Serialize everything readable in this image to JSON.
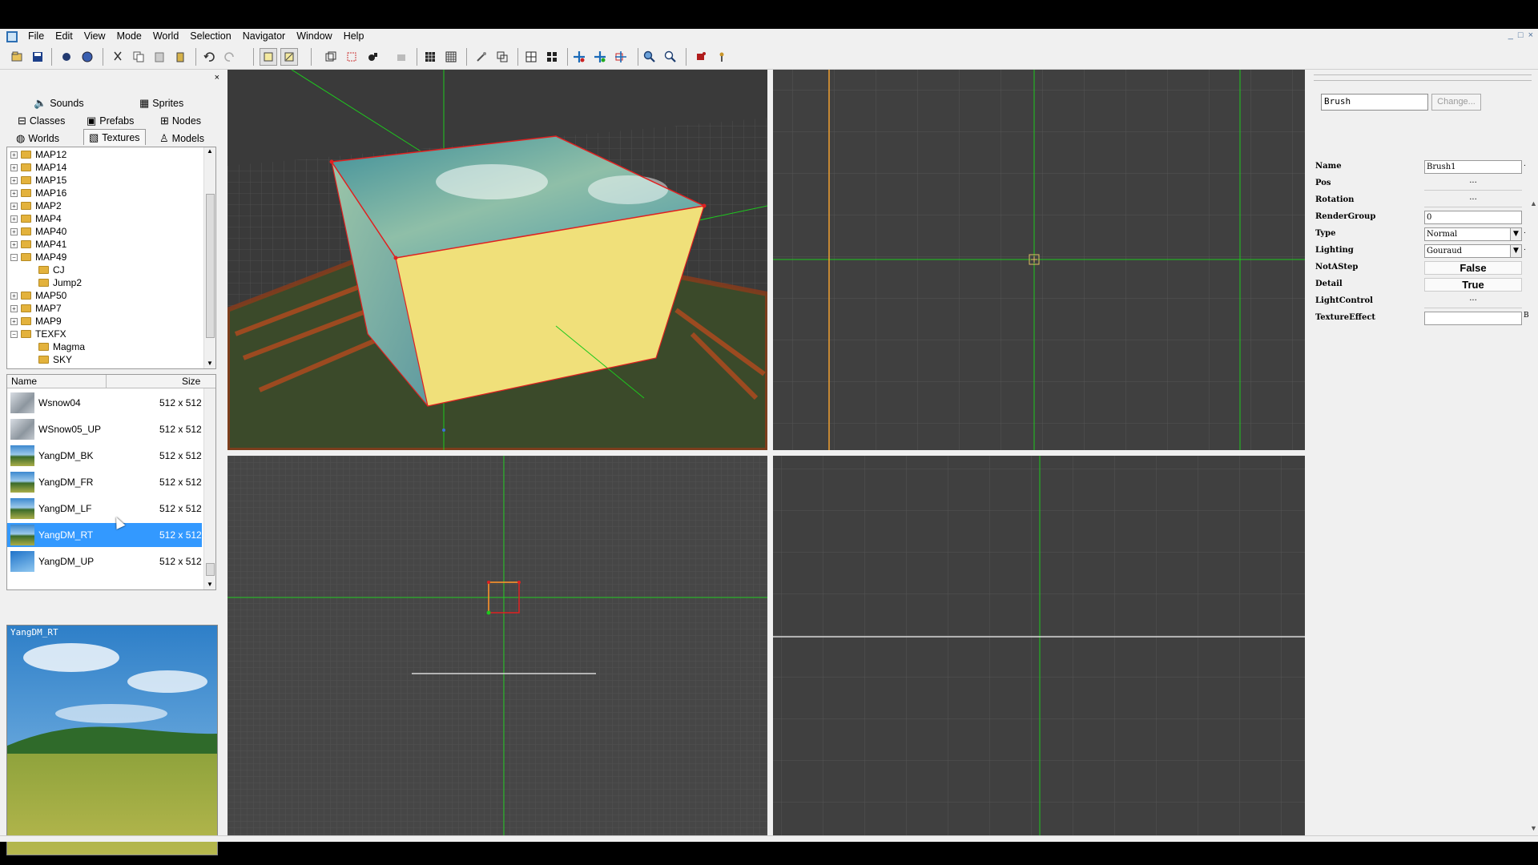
{
  "menu": [
    "File",
    "Edit",
    "View",
    "Mode",
    "World",
    "Selection",
    "Navigator",
    "Window",
    "Help"
  ],
  "window_controls": [
    "_",
    "□",
    "×"
  ],
  "left_close": "×",
  "tabs": {
    "sounds": "Sounds",
    "sprites": "Sprites",
    "classes": "Classes",
    "prefabs": "Prefabs",
    "nodes": "Nodes",
    "worlds": "Worlds",
    "textures": "Textures",
    "models": "Models"
  },
  "tree": [
    {
      "label": "MAP12",
      "expander": "+",
      "depth": 0
    },
    {
      "label": "MAP14",
      "expander": "+",
      "depth": 0
    },
    {
      "label": "MAP15",
      "expander": "+",
      "depth": 0
    },
    {
      "label": "MAP16",
      "expander": "+",
      "depth": 0
    },
    {
      "label": "MAP2",
      "expander": "+",
      "depth": 0
    },
    {
      "label": "MAP4",
      "expander": "+",
      "depth": 0
    },
    {
      "label": "MAP40",
      "expander": "+",
      "depth": 0
    },
    {
      "label": "MAP41",
      "expander": "+",
      "depth": 0
    },
    {
      "label": "MAP49",
      "expander": "−",
      "depth": 0
    },
    {
      "label": "CJ",
      "expander": "",
      "depth": 1
    },
    {
      "label": "Jump2",
      "expander": "",
      "depth": 1
    },
    {
      "label": "MAP50",
      "expander": "+",
      "depth": 0
    },
    {
      "label": "MAP7",
      "expander": "+",
      "depth": 0
    },
    {
      "label": "MAP9",
      "expander": "+",
      "depth": 0
    },
    {
      "label": "TEXFX",
      "expander": "−",
      "depth": 0
    },
    {
      "label": "Magma",
      "expander": "",
      "depth": 1
    },
    {
      "label": "SKY",
      "expander": "",
      "depth": 1
    }
  ],
  "list": {
    "col_name": "Name",
    "col_size": "Size",
    "rows": [
      {
        "name": "Wsnow04",
        "size": "512 x 512",
        "thumb": "snow"
      },
      {
        "name": "WSnow05_UP",
        "size": "512 x 512",
        "thumb": "snow"
      },
      {
        "name": "YangDM_BK",
        "size": "512 x 512",
        "thumb": "field"
      },
      {
        "name": "YangDM_FR",
        "size": "512 x 512",
        "thumb": "field"
      },
      {
        "name": "YangDM_LF",
        "size": "512 x 512",
        "thumb": "field"
      },
      {
        "name": "YangDM_RT",
        "size": "512 x 512",
        "thumb": "field",
        "selected": true
      },
      {
        "name": "YangDM_UP",
        "size": "512 x 512",
        "thumb": "sky"
      }
    ]
  },
  "preview": {
    "name": "YangDM_RT"
  },
  "properties": {
    "brush_field": "Brush",
    "change_button": "Change...",
    "rows": [
      {
        "label": "Name",
        "value": "Brush1",
        "kind": "text",
        "side": "."
      },
      {
        "label": "Pos",
        "value": "...",
        "kind": "dots",
        "side": ""
      },
      {
        "label": "Rotation",
        "value": "...",
        "kind": "dots",
        "side": ""
      },
      {
        "label": "RenderGroup",
        "value": "0",
        "kind": "text",
        "side": ""
      },
      {
        "label": "Type",
        "value": "Normal",
        "kind": "combo",
        "side": "."
      },
      {
        "label": "Lighting",
        "value": "Gouraud",
        "kind": "combo",
        "side": "."
      },
      {
        "label": "NotAStep",
        "value": "False",
        "kind": "flat",
        "side": ""
      },
      {
        "label": "Detail",
        "value": "True",
        "kind": "flat",
        "side": ""
      },
      {
        "label": "LightControl",
        "value": "...",
        "kind": "dots",
        "side": ""
      },
      {
        "label": "TextureEffect",
        "value": "",
        "kind": "text",
        "side": "B"
      }
    ]
  },
  "colors": {
    "grid_line": "#555555",
    "axis_green": "#1ec81e",
    "axis_orange": "#f0a030",
    "selection_red": "#e02020",
    "selection_blue": "#3399ff",
    "brush_face": "#f0e07a"
  }
}
